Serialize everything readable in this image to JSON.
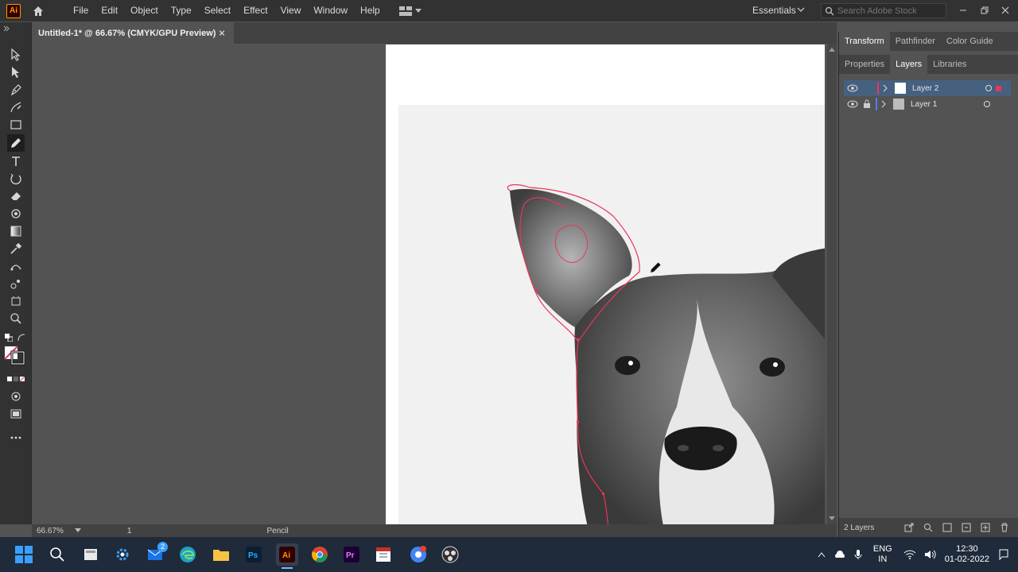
{
  "app": {
    "logo_text": "Ai"
  },
  "menu": [
    "File",
    "Edit",
    "Object",
    "Type",
    "Select",
    "Effect",
    "View",
    "Window",
    "Help"
  ],
  "workspace": {
    "label": "Essentials"
  },
  "search": {
    "placeholder": "Search Adobe Stock"
  },
  "document": {
    "tab_title": "Untitled-1* @ 66.67% (CMYK/GPU Preview)",
    "close_glyph": "×"
  },
  "status": {
    "zoom": "66.67%",
    "artboard_number": "1",
    "current_tool": "Pencil"
  },
  "panels": {
    "top_tabs": [
      "Transform",
      "Pathfinder",
      "Color Guide"
    ],
    "lower_tabs": [
      "Properties",
      "Layers",
      "Libraries"
    ],
    "layers": [
      {
        "name": "Layer 2",
        "selected": true,
        "locked": false,
        "color": "#e8365a"
      },
      {
        "name": "Layer 1",
        "selected": false,
        "locked": true,
        "color": "#4f7fff"
      }
    ],
    "layers_count": "2 Layers"
  },
  "taskbar": {
    "lang_top": "ENG",
    "lang_bottom": "IN",
    "time": "12:30",
    "date": "01-02-2022",
    "badge_ps": "2"
  },
  "colors": {
    "path_stroke": "#e8365a",
    "accent": "#46607f"
  },
  "icons": [
    "home-icon",
    "search-icon",
    "selection-tool-icon",
    "direct-selection-icon",
    "pen-tool-icon",
    "curvature-icon",
    "rectangle-tool-icon",
    "pencil-tool-icon",
    "type-tool-icon",
    "rotate-tool-icon",
    "eraser-icon",
    "warp-icon",
    "gradient-icon",
    "eyedropper-icon",
    "blend-icon",
    "artboard-icon",
    "zoom-icon",
    "eye-icon",
    "lock-icon",
    "chevron-icon"
  ]
}
